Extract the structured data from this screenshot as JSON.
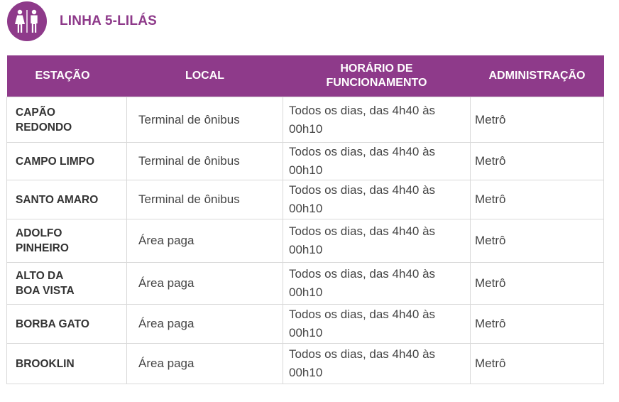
{
  "header": {
    "title": "LINHA 5-LILÁS",
    "icon": "restroom-icon",
    "accent_color": "#8e3a8a"
  },
  "table": {
    "columns": [
      "ESTAÇÃO",
      "LOCAL",
      "HORÁRIO DE\nFUNCIONAMENTO",
      "ADMINISTRAÇÃO"
    ],
    "rows": [
      {
        "station": "CAPÃO\nREDONDO",
        "local": "Terminal de ônibus",
        "hours": "Todos os dias, das 4h40 às 00h10",
        "admin": "Metrô"
      },
      {
        "station": "CAMPO LIMPO",
        "local": "Terminal de ônibus",
        "hours": "Todos os dias, das 4h40 às 00h10",
        "admin": "Metrô"
      },
      {
        "station": "SANTO AMARO",
        "local": "Terminal de ônibus",
        "hours": "Todos os dias, das 4h40 às 00h10",
        "admin": "Metrô"
      },
      {
        "station": "ADOLFO\nPINHEIRO",
        "local": "Área paga",
        "hours": "Todos os dias, das 4h40 às 00h10",
        "admin": "Metrô"
      },
      {
        "station": "ALTO DA\nBOA VISTA",
        "local": "Área paga",
        "hours": "Todos os dias, das 4h40 às 00h10",
        "admin": "Metrô"
      },
      {
        "station": "BORBA GATO",
        "local": "Área paga",
        "hours": "Todos os dias, das 4h40 às 00h10",
        "admin": "Metrô"
      },
      {
        "station": "BROOKLIN",
        "local": "Área paga",
        "hours": "Todos os dias, das 4h40 às 00h10",
        "admin": "Metrô"
      }
    ]
  }
}
